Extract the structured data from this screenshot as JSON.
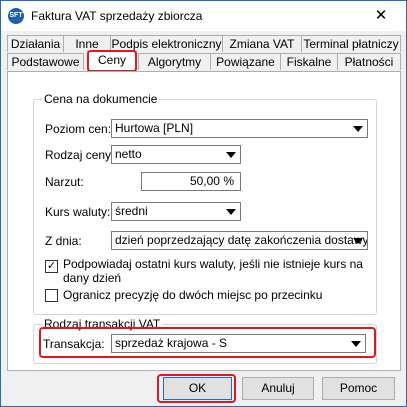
{
  "window": {
    "title": "Faktura VAT sprzedaży zbiorcza",
    "icon_text": "SFT",
    "close_glyph": "✕"
  },
  "tabs_row1": [
    "Działania",
    "Inne",
    "Podpis elektroniczny",
    "Zmiana VAT",
    "Terminal płatniczy"
  ],
  "tabs_row2": [
    "Podstawowe",
    "Ceny",
    "Algorytmy",
    "Powiązane",
    "Fiskalne",
    "Płatności"
  ],
  "active_tab": "Ceny",
  "price_group": {
    "legend": "Cena na dokumencie",
    "price_level_label": "Poziom cen:",
    "price_level_value": "Hurtowa [PLN]",
    "price_type_label": "Rodzaj ceny:",
    "price_type_value": "netto",
    "markup_label": "Narzut:",
    "markup_value": "50,00 %",
    "exchange_rate_label": "Kurs waluty:",
    "exchange_rate_value": "średni",
    "from_day_label": "Z dnia:",
    "from_day_value": "dzień poprzedzający datę zakończenia dostawy",
    "suggest_rate_checkbox_label_line1": "Podpowiadaj ostatni kurs waluty, jeśli nie istnieje kurs na",
    "suggest_rate_checkbox_label_line2": "dany dzień",
    "suggest_rate_checked": true,
    "suggest_rate_check_glyph": "✓",
    "limit_precision_checkbox_label": "Ogranicz precyzję do dwóch miejsc po przecinku",
    "limit_precision_checked": false
  },
  "vat_group": {
    "legend": "Rodzaj transakcji VAT",
    "transaction_label": "Transakcja:",
    "transaction_value": "sprzedaż krajowa - S"
  },
  "buttons": {
    "ok": "OK",
    "cancel": "Anuluj",
    "help": "Pomoc"
  },
  "colors": {
    "highlight": "#e2171d",
    "accent": "#1f5fa8"
  }
}
